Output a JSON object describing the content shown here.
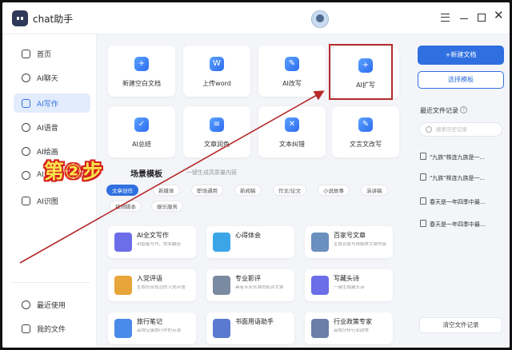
{
  "titlebar": {
    "app_title": "chat助手"
  },
  "sidebar": {
    "items": [
      {
        "label": "首页",
        "icon": "home-icon"
      },
      {
        "label": "AI聊天",
        "icon": "chat-icon"
      },
      {
        "label": "AI写作",
        "icon": "pen-icon",
        "active": true
      },
      {
        "label": "AI语音",
        "icon": "mic-icon"
      },
      {
        "label": "AI绘画",
        "icon": "palette-icon"
      },
      {
        "label": "AI",
        "icon": "magic-icon"
      },
      {
        "label": "AI识图",
        "icon": "scan-icon"
      }
    ],
    "bottom": [
      {
        "label": "最近使用",
        "icon": "clock-icon"
      },
      {
        "label": "我的文件",
        "icon": "folder-icon"
      }
    ]
  },
  "tools": [
    {
      "label": "新建空白文档",
      "glyph": "+"
    },
    {
      "label": "上传word",
      "glyph": "W"
    },
    {
      "label": "AI改写",
      "glyph": "✎"
    },
    {
      "label": "AI扩写",
      "glyph": "+"
    },
    {
      "label": "AI总结",
      "glyph": "✓"
    },
    {
      "label": "文章润色",
      "glyph": "≡"
    },
    {
      "label": "文本纠错",
      "glyph": "✕"
    },
    {
      "label": "文言文改写",
      "glyph": "✎"
    }
  ],
  "templates_section": {
    "title": "场景模板",
    "subtitle": "一键生成高质量内容",
    "tags": [
      "文章创作",
      "新媒体",
      "职场通用",
      "新闻稿",
      "作文/论文",
      "小说故事",
      "演讲稿",
      "视频脚本",
      "娱乐服务"
    ],
    "cards": [
      {
        "title": "AI全文写作",
        "desc": "AI智能写作，效率翻倍",
        "color": "#6b6ee8"
      },
      {
        "title": "心得体会",
        "desc": "",
        "color": "#3aa6e8"
      },
      {
        "title": "百家号文章",
        "desc": "生成百家号自媒体文章内容",
        "color": "#6b8fbf"
      },
      {
        "title": "入党评语",
        "desc": "生成符合规范的入党评语",
        "color": "#e8a53a"
      },
      {
        "title": "专业影评",
        "desc": "具有专业水准的影评文章",
        "color": "#7a8aa0"
      },
      {
        "title": "写藏头诗",
        "desc": "一键生成藏头诗",
        "color": "#6b6ee8"
      },
      {
        "title": "旅行笔记",
        "desc": "高效记录旅行中的点滴",
        "color": "#4a8ae8"
      },
      {
        "title": "书面用语助手",
        "desc": "",
        "color": "#5a7ad0"
      },
      {
        "title": "行业政策专家",
        "desc": "高效分析行业政策",
        "color": "#6b7fa8"
      }
    ]
  },
  "right_panel": {
    "new_doc_label": "+新建文档",
    "choose_template_label": "选择模板",
    "recent_title": "最近文件记录",
    "search_placeholder": "搜索历史记录",
    "recent_files": [
      "\"九族\"株连九族是一...",
      "\"九族\"株连九族是一...",
      "春天是一年四季中最...",
      "春天是一年四季中最..."
    ],
    "clear_label": "清空文件记录"
  },
  "overlay": {
    "step_label": "第②步"
  },
  "colors": {
    "accent": "#2f6fe0",
    "highlight_box": "#b62a2a",
    "arrow": "#b62a2a",
    "step_text": "#f7e34b"
  }
}
